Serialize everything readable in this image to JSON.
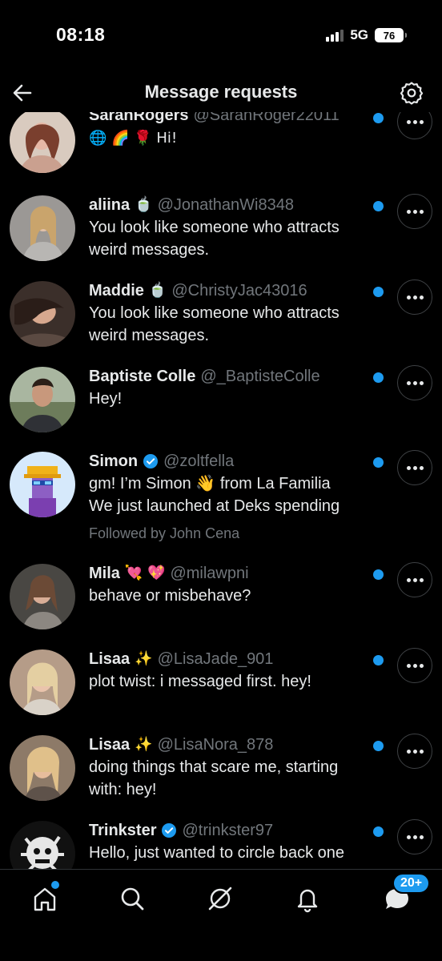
{
  "status": {
    "time": "08:18",
    "network": "5G",
    "battery": "76"
  },
  "header": {
    "title": "Message requests"
  },
  "messages": [
    {
      "name": "SarahRogers",
      "name_emoji": "",
      "verified": false,
      "handle": "@SarahRoger22011",
      "text": "🌐 🌈 🌹 Hi!",
      "text2": "",
      "followed_by": "",
      "avatar_color": "#b98a7d"
    },
    {
      "name": "aliina",
      "name_emoji": "🍵",
      "verified": false,
      "handle": "@JonathanWi8348",
      "text": "You look like someone who attracts",
      "text2": "weird messages.",
      "followed_by": "",
      "avatar_color": "#8d8a86"
    },
    {
      "name": "Maddie",
      "name_emoji": "🍵",
      "verified": false,
      "handle": "@ChristyJac43016",
      "text": "You look like someone who attracts",
      "text2": "weird messages.",
      "followed_by": "",
      "avatar_color": "#4a3a33"
    },
    {
      "name": "Baptiste Colle",
      "name_emoji": "",
      "verified": false,
      "handle": "@_BaptisteColle",
      "text": "Hey!",
      "text2": "",
      "followed_by": "",
      "avatar_color": "#6f7e6a"
    },
    {
      "name": "Simon",
      "name_emoji": "",
      "verified": true,
      "handle": "@zoltfella",
      "text": "gm! I’m Simon 👋 from La Familia",
      "text2": "We just launched at Deks spending",
      "followed_by": "Followed by John Cena",
      "avatar_color": "#cfe3f7"
    },
    {
      "name": "Mila",
      "name_emoji": "💘 💖",
      "verified": false,
      "handle": "@milawpni",
      "text": "behave or misbehave?",
      "text2": "",
      "followed_by": "",
      "avatar_color": "#5a4a44"
    },
    {
      "name": "Lisaa",
      "name_emoji": "✨",
      "verified": false,
      "handle": "@LisaJade_901",
      "text": "plot twist: i messaged first. hey!",
      "text2": "",
      "followed_by": "",
      "avatar_color": "#c8a58c"
    },
    {
      "name": "Lisaa",
      "name_emoji": "✨",
      "verified": false,
      "handle": "@LisaNora_878",
      "text": "doing things that scare me, starting",
      "text2": "with: hey!",
      "followed_by": "",
      "avatar_color": "#c9a27a"
    },
    {
      "name": "Trinkster",
      "name_emoji": "",
      "verified": true,
      "handle": "@trinkster97",
      "text": "Hello, just wanted to circle back one",
      "text2": "",
      "followed_by": "",
      "avatar_color": "#1a1a1a"
    }
  ],
  "nav": {
    "messages_badge": "20+"
  },
  "colors": {
    "accent": "#1d9bf0",
    "background": "#000000",
    "text": "#e7e9ea",
    "secondary": "#71767b"
  }
}
